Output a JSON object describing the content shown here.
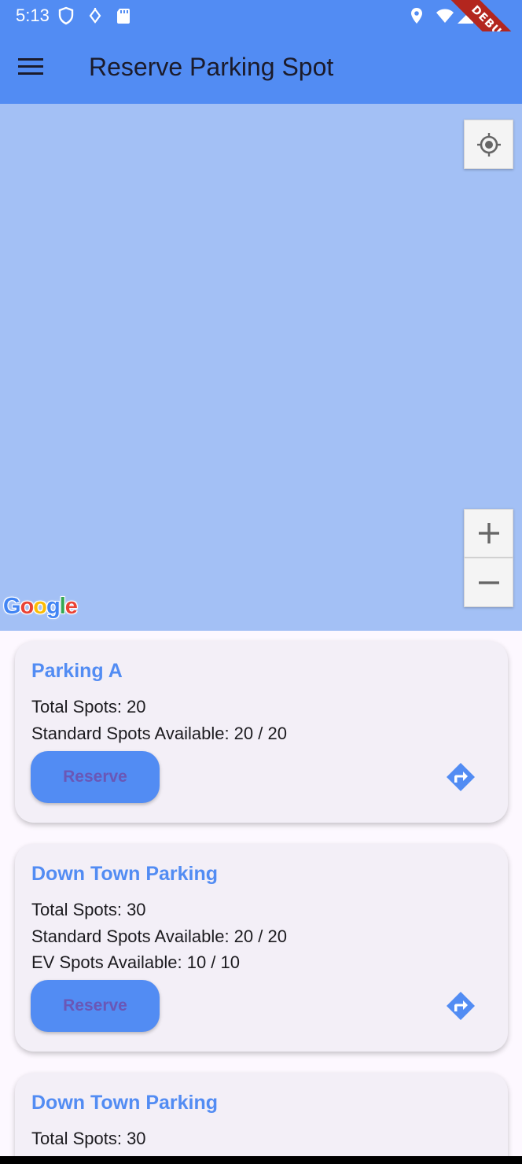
{
  "status_bar": {
    "time": "5:13",
    "debug_label": "DEBUG"
  },
  "app_bar": {
    "title": "Reserve Parking Spot"
  },
  "map": {
    "attribution": "Google"
  },
  "parkings": [
    {
      "name": "Parking A",
      "total": "Total Spots: 20",
      "standard": "Standard Spots Available: 20 / 20",
      "reserve_label": "Reserve"
    },
    {
      "name": "Down Town Parking",
      "total": "Total Spots: 30",
      "standard": "Standard Spots Available: 20 / 20",
      "ev": "EV Spots Available: 10 / 10",
      "reserve_label": "Reserve"
    },
    {
      "name": "Down Town Parking",
      "total": "Total Spots: 30"
    }
  ],
  "colors": {
    "primary": "#528cf3",
    "map_background": "#a3c0f5",
    "card_background": "#f3eff7",
    "debug_ribbon": "#b3261e",
    "reserve_text": "#6a57b6"
  },
  "icons": {
    "menu": "menu-icon",
    "locate": "my-location-icon",
    "zoom_in": "plus-icon",
    "zoom_out": "minus-icon",
    "directions": "directions-icon"
  }
}
